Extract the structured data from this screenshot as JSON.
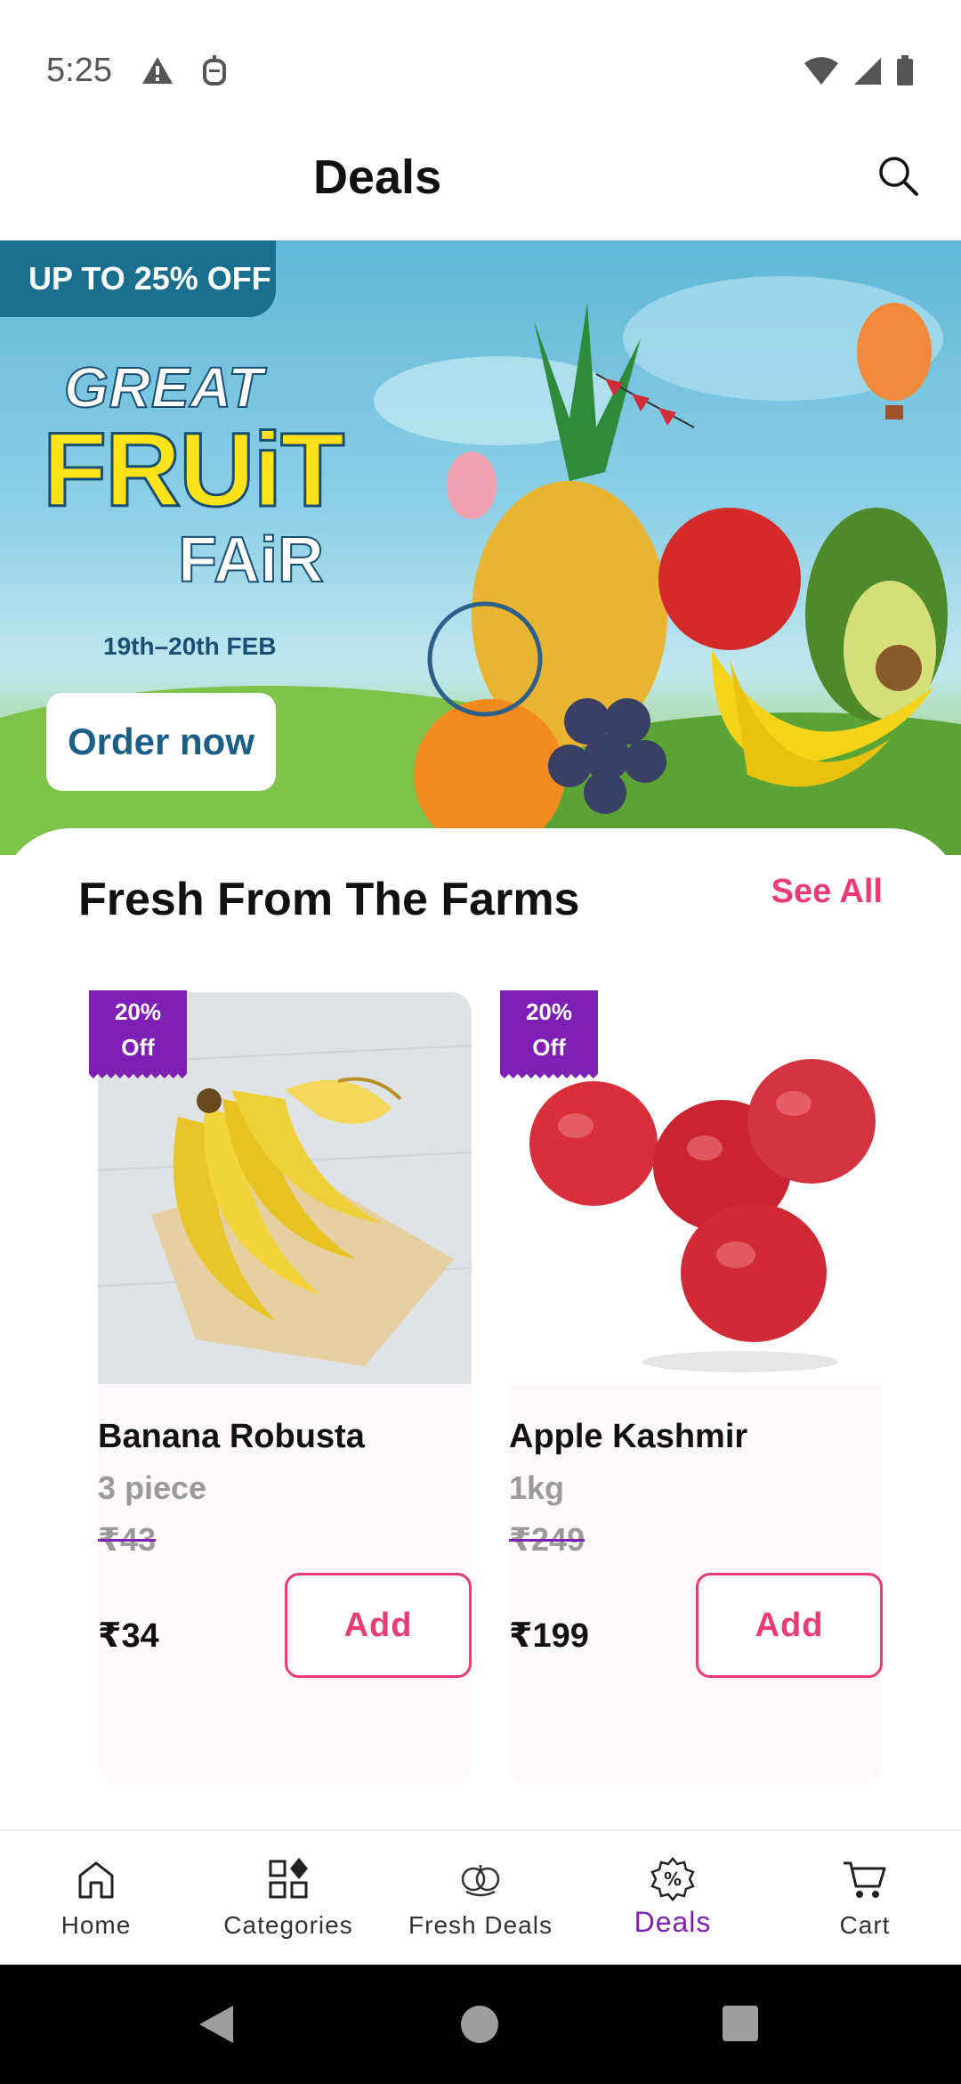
{
  "status_bar": {
    "time": "5:25"
  },
  "header": {
    "title": "Deals"
  },
  "banner": {
    "tag": "UP TO 25% OFF",
    "title_line1": "GREAT",
    "title_line2": "FRUiT",
    "title_line3": "FAiR",
    "date": "19th–20th FEB",
    "cta": "Order now"
  },
  "section": {
    "title": "Fresh From The Farms",
    "see_all": "See All"
  },
  "products": [
    {
      "name": "Banana Robusta",
      "quantity": "3 piece",
      "mrp": "₹43",
      "price": "₹34",
      "badge_line1": "20%",
      "badge_line2": "Off",
      "add_label": "Add"
    },
    {
      "name": "Apple Kashmir",
      "quantity": "1kg",
      "mrp": "₹249",
      "price": "₹199",
      "badge_line1": "20%",
      "badge_line2": "Off",
      "add_label": "Add"
    }
  ],
  "bottom_nav": {
    "items": [
      {
        "label": "Home",
        "icon": "home-icon"
      },
      {
        "label": "Categories",
        "icon": "categories-icon"
      },
      {
        "label": "Fresh Deals",
        "icon": "fresh-deals-icon"
      },
      {
        "label": "Deals",
        "icon": "deals-icon",
        "active": true
      },
      {
        "label": "Cart",
        "icon": "cart-icon"
      }
    ]
  },
  "colors": {
    "accent_pink": "#ea3c73",
    "accent_purple": "#7e1fb5",
    "banner_tag": "#1b6f8e"
  }
}
